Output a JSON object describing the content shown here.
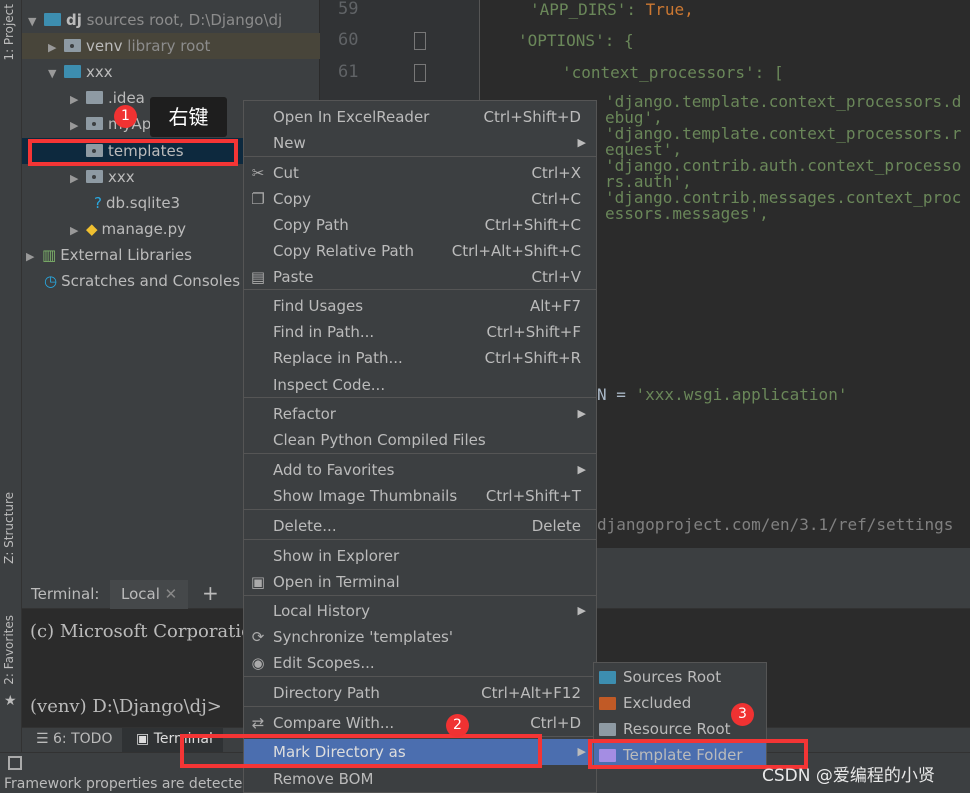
{
  "side_tabs": {
    "project": "1: Project",
    "structure": "Z: Structure",
    "favorites": "2: Favorites"
  },
  "tree": [
    {
      "name": "dj",
      "hint": "sources root,  D:\\Django\\dj",
      "expanded": true
    },
    {
      "name": "venv",
      "hint": "library root"
    },
    {
      "name": "xxx",
      "expanded": true
    },
    {
      "name": ".idea"
    },
    {
      "name": "myApp"
    },
    {
      "name": "templates",
      "selected": true
    },
    {
      "name": "xxx"
    },
    {
      "name": "db.sqlite3"
    },
    {
      "name": "manage.py"
    },
    {
      "name": "External Libraries"
    },
    {
      "name": "Scratches and Consoles"
    }
  ],
  "editor": {
    "line_numbers": [
      "59",
      "60",
      "61"
    ],
    "lines": {
      "l59a": "'APP_DIRS': ",
      "l59b": "True,",
      "l60": "'OPTIONS': {",
      "l61": "'context_processors': [",
      "l62": "'django.template.context_processors.debug',",
      "l63": "'django.template.context_processors.request',",
      "l64": "'django.contrib.auth.context_processors.auth',",
      "l65": "'django.contrib.messages.context_processors.messages',",
      "wsgi_a": "N = ",
      "wsgi_b": "'xxx.wsgi.application'",
      "url": "djangoproject.com/en/3.1/ref/settings"
    }
  },
  "terminal": {
    "label": "Terminal:",
    "tab": "Local",
    "add": "+",
    "line1": "(c) Microsoft Corporation",
    "line2": "(venv) D:\\Django\\dj>"
  },
  "tool_tabs": {
    "todo": "6: TODO",
    "terminal": "Terminal"
  },
  "status": "Framework properties are detected. // Configure",
  "annotation": {
    "tip": "右键",
    "b1": "1",
    "b2": "2",
    "b3": "3"
  },
  "menu": [
    {
      "label": "Open In ExcelReader",
      "shortcut": "Ctrl+Shift+D"
    },
    {
      "label": "New",
      "submenu": true
    },
    {
      "label": "Cut",
      "shortcut": "Ctrl+X",
      "icon": "scissors"
    },
    {
      "label": "Copy",
      "shortcut": "Ctrl+C",
      "icon": "copy"
    },
    {
      "label": "Copy Path",
      "shortcut": "Ctrl+Shift+C"
    },
    {
      "label": "Copy Relative Path",
      "shortcut": "Ctrl+Alt+Shift+C"
    },
    {
      "label": "Paste",
      "shortcut": "Ctrl+V",
      "icon": "clipboard"
    },
    {
      "label": "Find Usages",
      "shortcut": "Alt+F7"
    },
    {
      "label": "Find in Path...",
      "shortcut": "Ctrl+Shift+F"
    },
    {
      "label": "Replace in Path...",
      "shortcut": "Ctrl+Shift+R"
    },
    {
      "label": "Inspect Code..."
    },
    {
      "label": "Refactor",
      "submenu": true
    },
    {
      "label": "Clean Python Compiled Files"
    },
    {
      "label": "Add to Favorites",
      "submenu": true
    },
    {
      "label": "Show Image Thumbnails",
      "shortcut": "Ctrl+Shift+T"
    },
    {
      "label": "Delete...",
      "shortcut": "Delete"
    },
    {
      "label": "Show in Explorer"
    },
    {
      "label": "Open in Terminal",
      "icon": "terminal"
    },
    {
      "label": "Local History",
      "submenu": true
    },
    {
      "label": "Synchronize 'templates'",
      "icon": "sync"
    },
    {
      "label": "Edit Scopes...",
      "icon": "scope"
    },
    {
      "label": "Directory Path",
      "shortcut": "Ctrl+Alt+F12"
    },
    {
      "label": "Compare With...",
      "shortcut": "Ctrl+D",
      "icon": "compare"
    },
    {
      "label": "Mark Directory as",
      "submenu": true,
      "highlighted": true
    },
    {
      "label": "Remove BOM"
    }
  ],
  "submenu": [
    {
      "label": "Sources Root",
      "color": "#3d8eb0"
    },
    {
      "label": "Excluded",
      "color": "#c15a26"
    },
    {
      "label": "Resource Root",
      "color": "#8e9aa3"
    },
    {
      "label": "Template Folder",
      "color": "#a48de3",
      "highlighted": true
    }
  ],
  "watermark": "CSDN @爱编程的小贤",
  "colors": {
    "menu_bg": "#3c3f41",
    "highlight": "#4b6eaf",
    "annotation_red": "#f43535",
    "string": "#6a8759",
    "keyword": "#cc7832"
  }
}
